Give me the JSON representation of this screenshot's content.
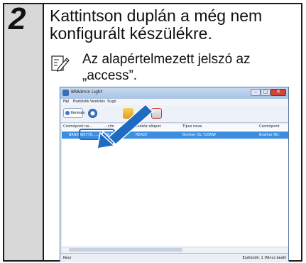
{
  "step": {
    "number": "2",
    "instruction": "Kattintson duplán a még nem konfigurált készülékre.",
    "note": "Az alapértelmezett jelszó az „access”.",
    "icon": "pencil-note-icon"
  },
  "screenshot": {
    "title": "BRAdmin Light",
    "window_buttons": [
      "–",
      "□",
      "✕"
    ],
    "menu": [
      "Fájl",
      "Eszközök",
      "Vezérlés",
      "Súgó"
    ],
    "toolbar": {
      "search_label": "Keresés"
    },
    "columns": [
      "Csomópont ne...",
      "...cím",
      "Eszköz állapot",
      "Típus neve",
      "Csomópont"
    ],
    "row": [
      "BRN0080770...",
      "...2.168.3.6",
      "READY",
      "Brother QL-720NW",
      "Brother NC-"
    ],
    "status_left": "Kész",
    "status_right": "Eszközök: 1   (Nincs beállí",
    "colors": {
      "selection": "#3b8ee0",
      "highlight": "#1e6fc4",
      "arrow": "#1f6bc2"
    }
  }
}
